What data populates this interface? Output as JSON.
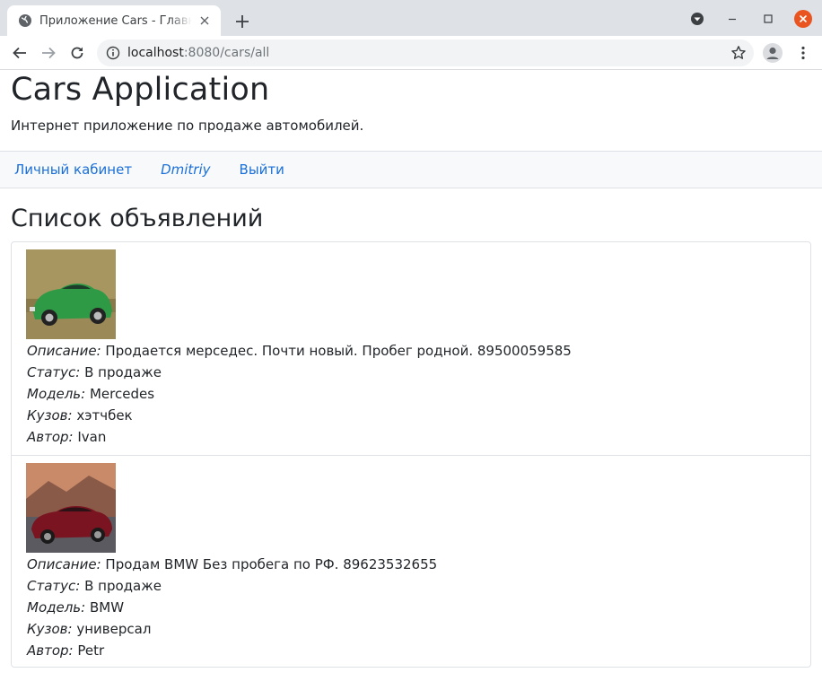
{
  "browser": {
    "tab_title": "Приложение Cars - Главная",
    "url_host": "localhost",
    "url_rest": ":8080/cars/all"
  },
  "site": {
    "title": "Cars Application",
    "subtitle": "Интернет приложение по продаже автомобилей."
  },
  "nav": {
    "cabinet": "Личный кабинет",
    "user": "Dmitriy",
    "logout": "Выйти"
  },
  "list": {
    "title": "Список объявлений",
    "labels": {
      "description": "Описание:",
      "status": "Статус:",
      "model": "Модель:",
      "body": "Кузов:",
      "author": "Автор:"
    },
    "ads": [
      {
        "image": "green-sports-car",
        "description": "Продается мерседес. Почти новый. Пробег родной. 89500059585",
        "status": "В продаже",
        "model": "Mercedes",
        "body": "хэтчбек",
        "author": "Ivan"
      },
      {
        "image": "red-coupe-car",
        "description": "Продам BMW Без пробега по РФ. 89623532655",
        "status": "В продаже",
        "model": "BMW",
        "body": "универсал",
        "author": "Petr"
      }
    ]
  },
  "colors": {
    "link": "#1a6fd8",
    "close_button": "#e95420"
  }
}
